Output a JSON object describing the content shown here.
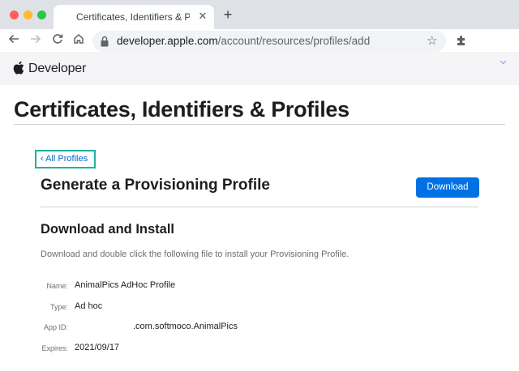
{
  "browser": {
    "tab_title": "Certificates, Identifiers & Profiles",
    "new_tab_symbol": "+",
    "close_symbol": "✕",
    "url_host": "developer.apple.com",
    "url_path": "/account/resources/profiles/add"
  },
  "site_nav": {
    "label": "Developer"
  },
  "page": {
    "title": "Certificates, Identifiers & Profiles",
    "back_link": "‹ All Profiles",
    "heading": "Generate a Provisioning Profile",
    "download_label": "Download",
    "section_title": "Download and Install",
    "description": "Download and double click the following file to install your Provisioning Profile.",
    "details": [
      {
        "label": "Name:",
        "value": "AnimalPics AdHoc Profile"
      },
      {
        "label": "Type:",
        "value": "Ad hoc"
      },
      {
        "label": "App ID:",
        "value": ".com.softmoco.AnimalPics"
      },
      {
        "label": "Expires:",
        "value": "2021/09/17"
      }
    ]
  },
  "colors": {
    "accent": "#0071e3",
    "link": "#0066cc",
    "highlight_border": "#1bb29e"
  },
  "icons": [
    "apple-favicon-icon",
    "close-icon",
    "plus-icon",
    "back-arrow-icon",
    "forward-arrow-icon",
    "reload-icon",
    "home-icon",
    "lock-icon",
    "star-icon",
    "puzzle-extension-icon",
    "apple-logo-icon",
    "chevron-down-icon"
  ]
}
